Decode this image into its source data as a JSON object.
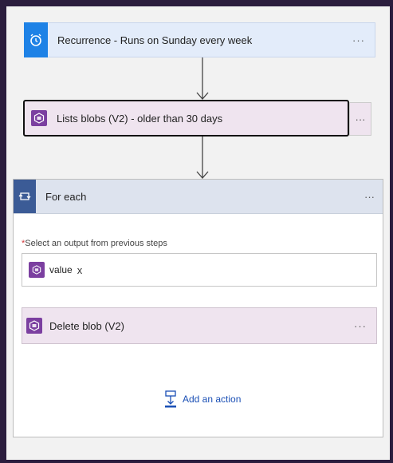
{
  "recurrence": {
    "label": "Recurrence - Runs on Sunday every week",
    "more": "···"
  },
  "list_blobs": {
    "label": "Lists blobs (V2) - older than 30 days",
    "more": "···"
  },
  "for_each": {
    "title": "For each",
    "more": "···",
    "required_mark": "*",
    "select_label": "Select an output from previous steps",
    "token_label": "value",
    "token_remove": "x",
    "delete_blob": {
      "label": "Delete blob (V2)",
      "more": "···"
    },
    "add_action_label": "Add an action"
  },
  "colors": {
    "accent_blue": "#1e82e6",
    "storage_purple": "#7b3fa0",
    "foreach_header_icon": "#3b5b96",
    "link": "#1a4fb5"
  }
}
